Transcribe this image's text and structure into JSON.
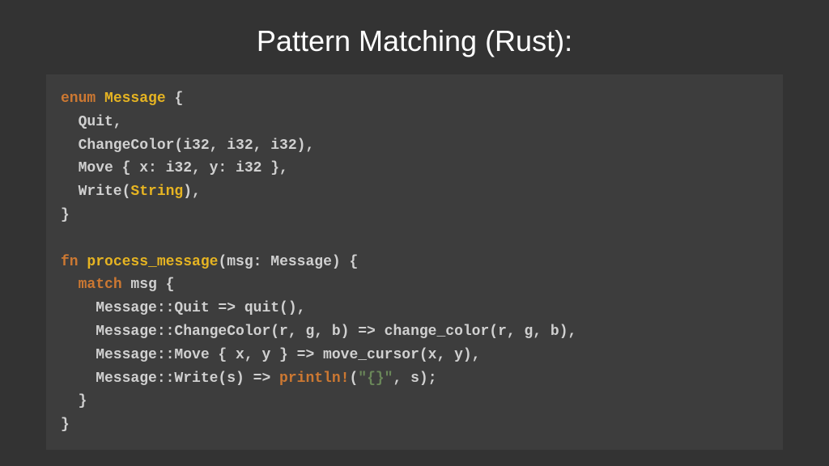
{
  "title": "Pattern Matching (Rust):",
  "code": {
    "enum_kw": "enum",
    "enum_name": "Message",
    "enum_open": " {",
    "variant_quit": "  Quit,",
    "variant_changecolor": "  ChangeColor(i32, i32, i32),",
    "variant_move": "  Move { x: i32, y: i32 },",
    "variant_write_pre": "  Write(",
    "variant_write_type": "String",
    "variant_write_post": "),",
    "enum_close": "}",
    "blank": "",
    "fn_kw": "fn",
    "fn_name": "process_message",
    "fn_sig": "(msg: Message) {",
    "match_indent": "  ",
    "match_kw": "match",
    "match_expr": " msg {",
    "arm_quit": "    Message::Quit => quit(),",
    "arm_changecolor": "    Message::ChangeColor(r, g, b) => change_color(r, g, b),",
    "arm_move": "    Message::Move { x, y } => move_cursor(x, y),",
    "arm_write_pre": "    Message::Write(s) => ",
    "arm_write_macro": "println!",
    "arm_write_paren": "(",
    "arm_write_str": "\"{}\"",
    "arm_write_post": ", s);",
    "match_close": "  }",
    "fn_close": "}"
  }
}
